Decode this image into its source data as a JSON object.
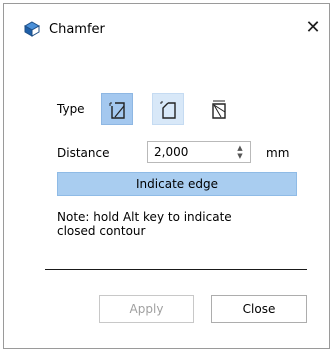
{
  "window": {
    "title": "Chamfer",
    "icon": "chamfer-cube-icon",
    "close_glyph": "✕"
  },
  "type_row": {
    "label": "Type",
    "options": [
      {
        "icon": "chamfer-type-1-icon",
        "state": "selected"
      },
      {
        "icon": "chamfer-type-2-icon",
        "state": "hover"
      },
      {
        "icon": "chamfer-type-3-icon",
        "state": "normal"
      }
    ]
  },
  "distance": {
    "label": "Distance",
    "value": "2,000",
    "unit": "mm"
  },
  "indicate_edge": {
    "label": "Indicate edge"
  },
  "note": "Note: hold Alt key to indicate\nclosed contour",
  "buttons": {
    "apply": "Apply",
    "close": "Close"
  },
  "colors": {
    "selected_bg": "#a4c8ef",
    "hover_bg": "#d8e8f8",
    "indicate_bg": "#a9cdf0",
    "disabled_text": "#a0a0a0"
  }
}
